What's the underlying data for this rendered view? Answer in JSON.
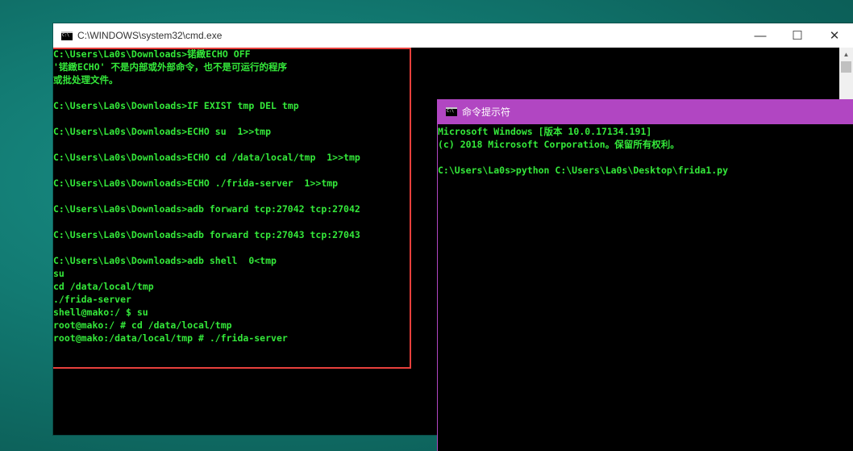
{
  "window_back": {
    "title": "C:\\WINDOWS\\system32\\cmd.exe",
    "controls": {
      "minimize": "—",
      "maximize": "☐",
      "close": "✕"
    },
    "lines": [
      "C:\\Users\\La0s\\Downloads>锘緻ECHO OFF",
      "'锘緻ECHO' 不是内部或外部命令，也不是可运行的程序",
      "或批处理文件。",
      "",
      "C:\\Users\\La0s\\Downloads>IF EXIST tmp DEL tmp",
      "",
      "C:\\Users\\La0s\\Downloads>ECHO su  1>>tmp",
      "",
      "C:\\Users\\La0s\\Downloads>ECHO cd /data/local/tmp  1>>tmp",
      "",
      "C:\\Users\\La0s\\Downloads>ECHO ./frida-server  1>>tmp",
      "",
      "C:\\Users\\La0s\\Downloads>adb forward tcp:27042 tcp:27042",
      "",
      "C:\\Users\\La0s\\Downloads>adb forward tcp:27043 tcp:27043",
      "",
      "C:\\Users\\La0s\\Downloads>adb shell  0<tmp",
      "su",
      "cd /data/local/tmp",
      "./frida-server",
      "shell@mako:/ $ su",
      "root@mako:/ # cd /data/local/tmp",
      "root@mako:/data/local/tmp # ./frida-server"
    ]
  },
  "window_front": {
    "title": "命令提示符",
    "lines": [
      "Microsoft Windows [版本 10.0.17134.191]",
      "(c) 2018 Microsoft Corporation。保留所有权利。",
      "",
      "C:\\Users\\La0s>python C:\\Users\\La0s\\Desktop\\frida1.py"
    ]
  },
  "colors": {
    "console_text": "#34e83a",
    "highlight_box": "#e8403c",
    "front_titlebar": "#b146c2"
  }
}
